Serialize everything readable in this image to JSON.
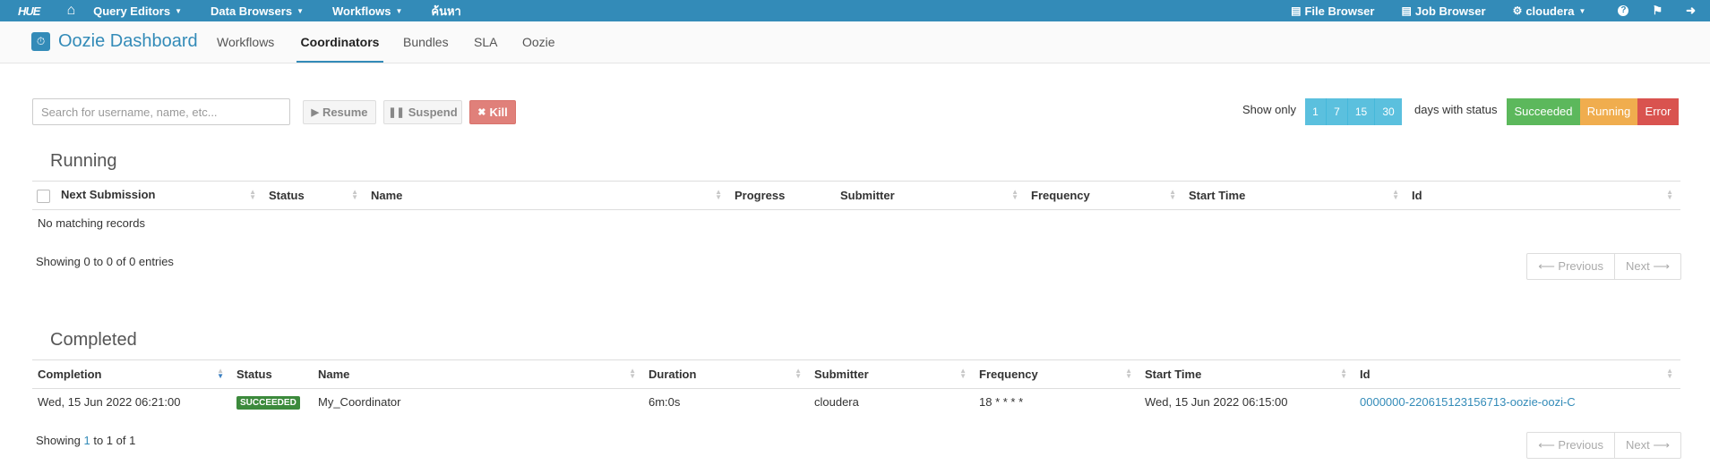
{
  "topnav": {
    "logo": "HUE",
    "home_icon": "home-icon",
    "menus": [
      {
        "label": "Query Editors"
      },
      {
        "label": "Data Browsers"
      },
      {
        "label": "Workflows"
      },
      {
        "label": "ค้นหา"
      }
    ],
    "right": [
      {
        "icon": "file-icon",
        "label": "File Browser"
      },
      {
        "icon": "list-icon",
        "label": "Job Browser"
      },
      {
        "icon": "cogs-icon",
        "label": "cloudera"
      }
    ],
    "icons": [
      "help-icon",
      "flag-icon",
      "sign-out-icon"
    ]
  },
  "subnav": {
    "app_title": "Oozie Dashboard",
    "tabs": [
      {
        "label": "Workflows",
        "active": false
      },
      {
        "label": "Coordinators",
        "active": true
      },
      {
        "label": "Bundles",
        "active": false
      },
      {
        "label": "SLA",
        "active": false
      },
      {
        "label": "Oozie",
        "active": false
      }
    ]
  },
  "toolbar": {
    "search_placeholder": "Search for username, name, etc...",
    "resume_label": "Resume",
    "suspend_label": "Suspend",
    "kill_label": "Kill",
    "show_only_label": "Show only",
    "days": [
      "1",
      "7",
      "15",
      "30"
    ],
    "days_with_status_label": "days with status",
    "statuses": [
      {
        "label": "Succeeded",
        "color": "#5cb85c"
      },
      {
        "label": "Running",
        "color": "#f0ad4e"
      },
      {
        "label": "Error",
        "color": "#d9534f"
      }
    ]
  },
  "running": {
    "title": "Running",
    "columns": [
      "Next Submission",
      "Status",
      "Name",
      "Progress",
      "Submitter",
      "Frequency",
      "Start Time",
      "Id"
    ],
    "empty_message": "No matching records",
    "info": "Showing 0 to 0 of 0 entries",
    "prev_label": "⟵ Previous",
    "next_label": "Next ⟶"
  },
  "completed": {
    "title": "Completed",
    "columns": [
      "Completion",
      "Status",
      "Name",
      "Duration",
      "Submitter",
      "Frequency",
      "Start Time",
      "Id"
    ],
    "rows": [
      {
        "completion": "Wed, 15 Jun 2022 06:21:00",
        "status": "SUCCEEDED",
        "name": "My_Coordinator",
        "duration": "6m:0s",
        "submitter": "cloudera",
        "frequency": "18 * * * *",
        "start_time": "Wed, 15 Jun 2022 06:15:00",
        "id": "0000000-220615123156713-oozie-oozi-C"
      }
    ],
    "info_prefix": "Showing ",
    "info_start": "1",
    "info_mid": " to ",
    "info_end": "1",
    "info_suffix": " of 1",
    "prev_label": "⟵ Previous",
    "next_label": "Next ⟶"
  },
  "colors": {
    "nav_blue": "#338bb8",
    "day_blue": "#5bc0de",
    "kill_red": "#e0807a",
    "badge_green": "#3c8a3c"
  }
}
